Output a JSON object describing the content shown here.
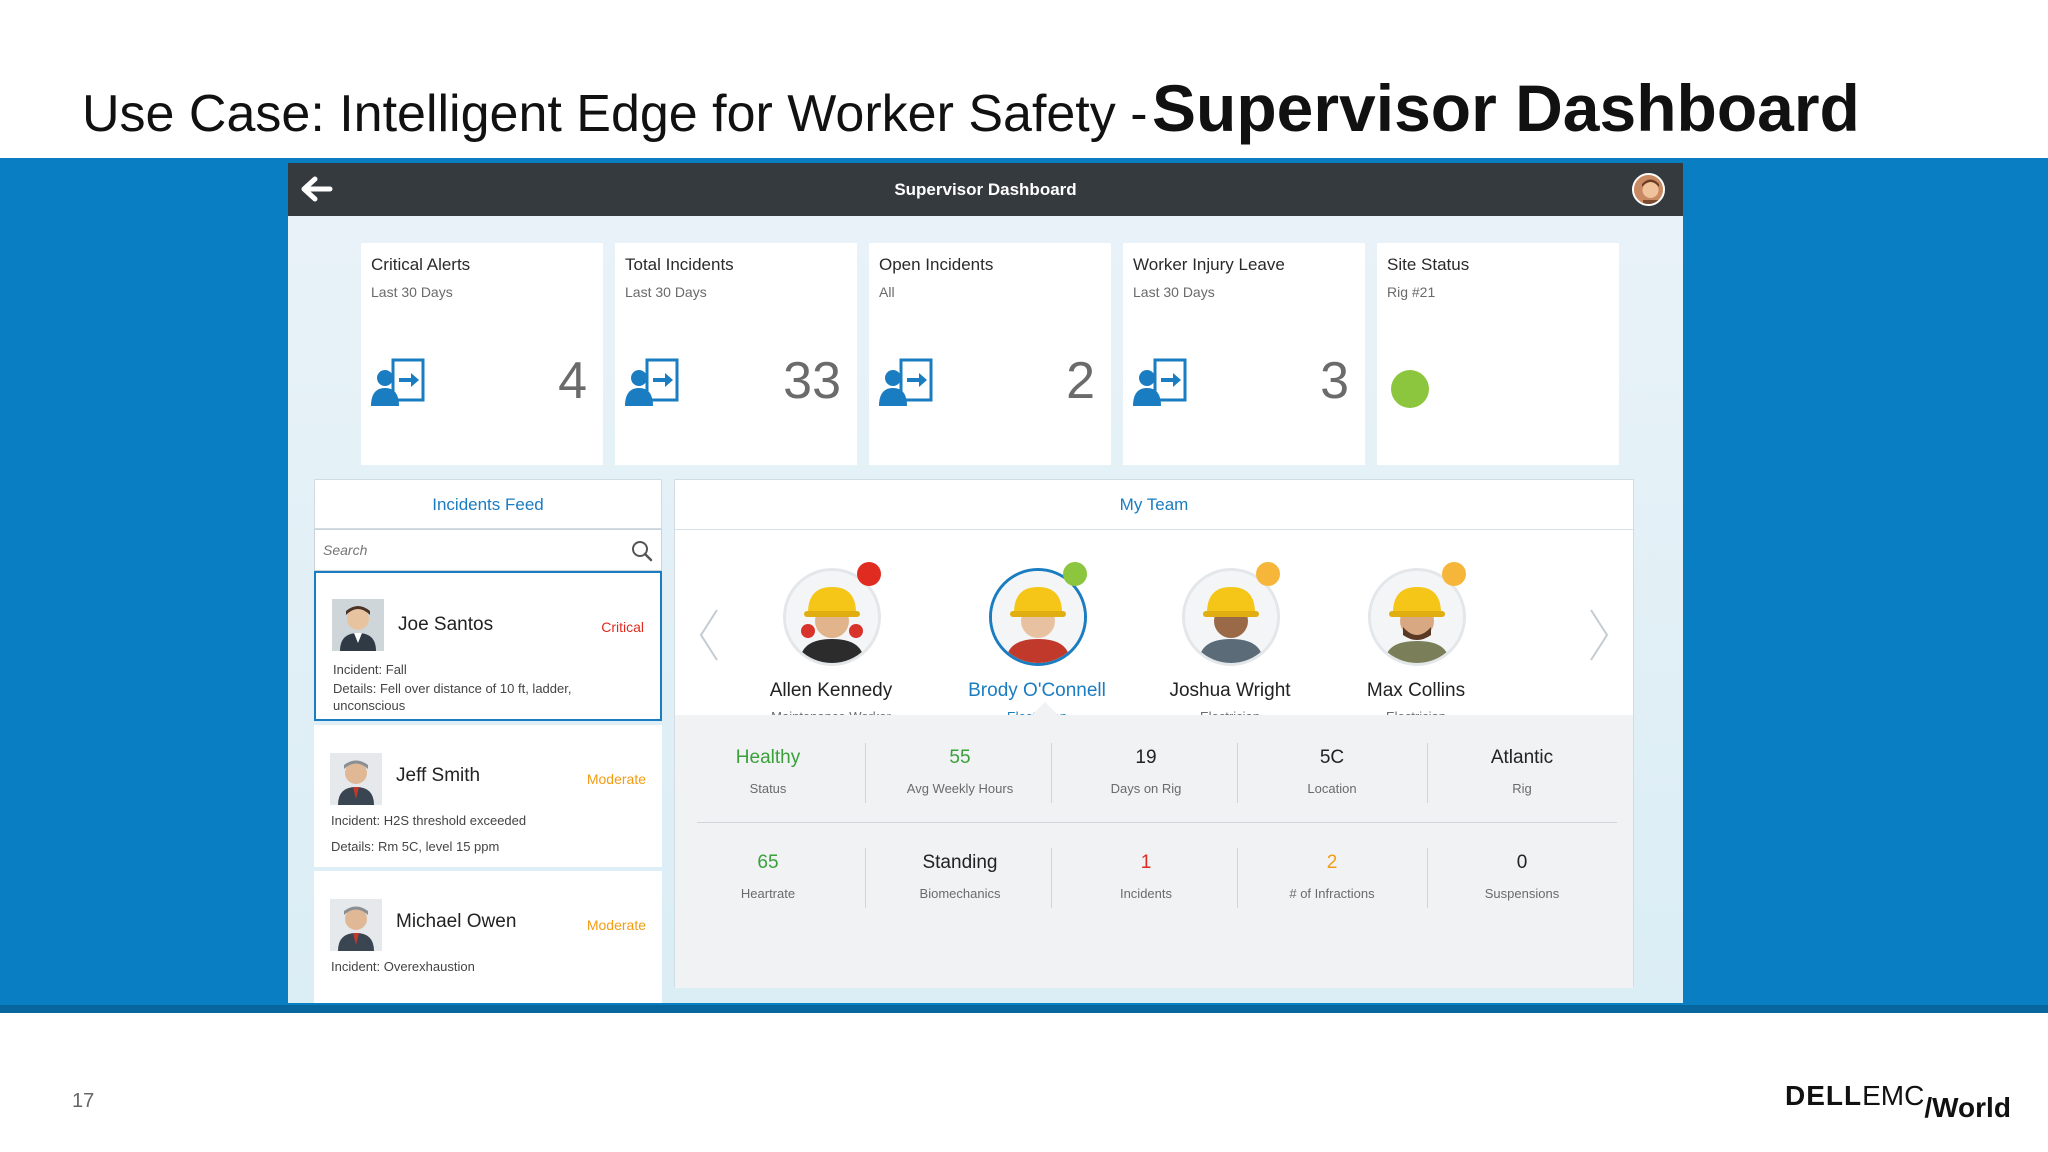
{
  "slide": {
    "title_plain": "Use Case: Intelligent Edge for Worker Safety -",
    "title_bold": "Supervisor Dashboard",
    "page_number": "17",
    "logo_dell": "DELL",
    "logo_emc": "EMC",
    "logo_world": "/World"
  },
  "app": {
    "title": "Supervisor Dashboard",
    "back_icon": "arrow-left-icon"
  },
  "kpis": [
    {
      "title": "Critical Alerts",
      "sub": "Last 30 Days",
      "value": "4",
      "icon": "user-incident-icon"
    },
    {
      "title": "Total Incidents",
      "sub": "Last 30 Days",
      "value": "33",
      "icon": "user-incident-icon"
    },
    {
      "title": "Open Incidents",
      "sub": "All",
      "value": "2",
      "icon": "user-incident-icon"
    },
    {
      "title": "Worker Injury Leave",
      "sub": "Last 30 Days",
      "value": "3",
      "icon": "user-incident-icon"
    },
    {
      "title": "Site Status",
      "sub": "Rig #21",
      "status_color": "#8cc63f"
    }
  ],
  "feed": {
    "title": "Incidents Feed",
    "search_placeholder": "Search",
    "items": [
      {
        "name": "Joe Santos",
        "severity": "Critical",
        "severity_color": "#e02b20",
        "line1": "Incident: Fall",
        "line2": "Details: Fell over distance of 10 ft, ladder,",
        "line3": "unconscious"
      },
      {
        "name": "Jeff Smith",
        "severity": "Moderate",
        "severity_color": "#f39c12",
        "line1": "Incident: H2S threshold exceeded",
        "line2": "Details: Rm 5C, level 15 ppm"
      },
      {
        "name": "Michael Owen",
        "severity": "Moderate",
        "severity_color": "#f39c12",
        "line1": "Incident: Overexhaustion"
      }
    ]
  },
  "team": {
    "title": "My Team",
    "members": [
      {
        "name": "Allen Kennedy",
        "role": "Maintenance Worker",
        "dot_color": "#e02b20"
      },
      {
        "name": "Brody O'Connell",
        "role": "Electrician",
        "dot_color": "#8cc63f"
      },
      {
        "name": "Joshua Wright",
        "role": "Electrician",
        "dot_color": "#f5b63a"
      },
      {
        "name": "Max Collins",
        "role": "Electrician",
        "dot_color": "#f5b63a"
      }
    ],
    "stats_row1": [
      {
        "value": "Healthy",
        "label": "Status",
        "color": "#3aa03a"
      },
      {
        "value": "55",
        "label": "Avg Weekly Hours",
        "color": "#3aa03a"
      },
      {
        "value": "19",
        "label": "Days on Rig",
        "color": "#222222"
      },
      {
        "value": "5C",
        "label": "Location",
        "color": "#222222"
      },
      {
        "value": "Atlantic",
        "label": "Rig",
        "color": "#222222"
      }
    ],
    "stats_row2": [
      {
        "value": "65",
        "label": "Heartrate",
        "color": "#3aa03a"
      },
      {
        "value": "Standing",
        "label": "Biomechanics",
        "color": "#222222"
      },
      {
        "value": "1",
        "label": "Incidents",
        "color": "#e02b20"
      },
      {
        "value": "2",
        "label": "# of Infractions",
        "color": "#f39c12"
      },
      {
        "value": "0",
        "label": "Suspensions",
        "color": "#222222"
      }
    ]
  },
  "colors": {
    "band": "#0a7ec2",
    "accent": "#1a7cc1",
    "header": "#353a3f"
  }
}
